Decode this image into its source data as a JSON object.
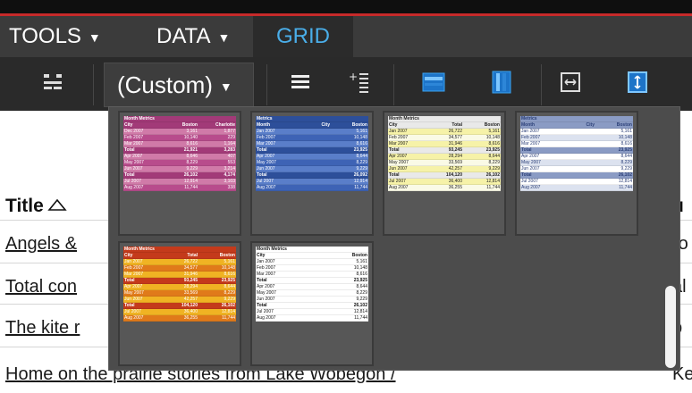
{
  "menu": {
    "items": [
      {
        "label": "TOOLS",
        "has_dropdown": true
      },
      {
        "label": "DATA",
        "has_dropdown": true
      },
      {
        "label": "GRID",
        "has_dropdown": false,
        "active": true
      }
    ]
  },
  "toolbar": {
    "style_select": {
      "value": "(Custom)",
      "caret": "▾"
    },
    "icons": [
      "grid-layout-icon",
      "outline-rows-icon",
      "add-subtotal-icon",
      "banding-rows-icon",
      "banding-columns-icon",
      "fit-to-content-icon",
      "fit-to-window-icon"
    ]
  },
  "colors": {
    "accent": "#4aaee9",
    "menubar": "#3b3b3b",
    "toolbar": "#2a2a2a",
    "topline": "#c62a2a"
  },
  "style_gallery": {
    "thumbnails": [
      {
        "name": "magenta-style",
        "header_bg": "#a23a78",
        "row_a": "#b84c8c",
        "row_b": "#d07aa8",
        "text": "#ffffff",
        "rows": [
          [
            "Month Metrics",
            "",
            ""
          ],
          [
            "City",
            "Boston",
            "Charlotte"
          ],
          [
            "Dec 2007",
            "3,161",
            "1,877"
          ],
          [
            "Feb 2007",
            "10,140",
            "229"
          ],
          [
            "Mar 2007",
            "8,616",
            "1,164"
          ],
          [
            "Total",
            "21,921",
            "3,283"
          ],
          [
            "Apr 2007",
            "8,646",
            "407"
          ],
          [
            "May 2007",
            "8,229",
            "553"
          ],
          [
            "Jun 2007",
            "9,229",
            "3,214"
          ],
          [
            "Total",
            "26,102",
            "4,174"
          ],
          [
            "Jul 2007",
            "12,914",
            "3,103"
          ],
          [
            "Aug 2007",
            "11,744",
            "338"
          ]
        ]
      },
      {
        "name": "blue-style",
        "header_bg": "#2d4f9a",
        "row_a": "#3e63b5",
        "row_b": "#5a7ec9",
        "text": "#ffffff",
        "rows": [
          [
            "Metrics",
            "",
            ""
          ],
          [
            "Month",
            "City",
            "Boston"
          ],
          [
            "Jan 2007",
            "",
            "5,161"
          ],
          [
            "Feb 2007",
            "",
            "10,148"
          ],
          [
            "Mar 2007",
            "",
            "8,616"
          ],
          [
            "Total",
            "",
            "23,925"
          ],
          [
            "Apr 2007",
            "",
            "8,644"
          ],
          [
            "May 2007",
            "",
            "8,229"
          ],
          [
            "Jun 2007",
            "",
            "9,229"
          ],
          [
            "Total",
            "",
            "26,092"
          ],
          [
            "Jul 2007",
            "",
            "12,914"
          ],
          [
            "Aug 2007",
            "",
            "11,744"
          ]
        ]
      },
      {
        "name": "yellow-style",
        "header_bg": "#e9e9e9",
        "row_a": "#fafae6",
        "row_b": "#f6f2a8",
        "text": "#222222",
        "rows": [
          [
            "Month Metrics",
            "",
            ""
          ],
          [
            "City",
            "Total",
            "Boston"
          ],
          [
            "Jan 2007",
            "26,722",
            "5,161"
          ],
          [
            "Feb 2007",
            "34,577",
            "10,148"
          ],
          [
            "Mar 2007",
            "31,946",
            "8,616"
          ],
          [
            "Total",
            "93,245",
            "23,925"
          ],
          [
            "Apr 2007",
            "28,294",
            "8,644"
          ],
          [
            "May 2007",
            "33,569",
            "8,229"
          ],
          [
            "Jun 2007",
            "42,257",
            "9,229"
          ],
          [
            "Total",
            "104,120",
            "26,102"
          ],
          [
            "Jul 2007",
            "36,400",
            "12,814"
          ],
          [
            "Aug 2007",
            "36,255",
            "11,744"
          ]
        ]
      },
      {
        "name": "grey-blue-style",
        "header_bg": "#8a9bc4",
        "row_a": "#dce2ef",
        "row_b": "#ffffff",
        "text": "#2a3e76",
        "rows": [
          [
            "Metrics",
            "",
            ""
          ],
          [
            "Month",
            "City",
            "Boston"
          ],
          [
            "Jan 2007",
            "",
            "5,161"
          ],
          [
            "Feb 2007",
            "",
            "10,148"
          ],
          [
            "Mar 2007",
            "",
            "8,616"
          ],
          [
            "Total",
            "",
            "23,925"
          ],
          [
            "Apr 2007",
            "",
            "8,644"
          ],
          [
            "May 2007",
            "",
            "8,229"
          ],
          [
            "Jun 2007",
            "",
            "9,229"
          ],
          [
            "Total",
            "",
            "26,102"
          ],
          [
            "Jul 2007",
            "",
            "12,814"
          ],
          [
            "Aug 2007",
            "",
            "11,744"
          ]
        ]
      },
      {
        "name": "orange-style",
        "header_bg": "#c43a1b",
        "row_a": "#e07a1a",
        "row_b": "#f0b323",
        "text": "#ffffff",
        "rows": [
          [
            "Month Metrics",
            "",
            ""
          ],
          [
            "City",
            "Total",
            "Boston"
          ],
          [
            "Jan 2007",
            "26,722",
            "5,161"
          ],
          [
            "Feb 2007",
            "34,577",
            "10,148"
          ],
          [
            "Mar 2007",
            "31,946",
            "8,616"
          ],
          [
            "Total",
            "93,245",
            "23,925"
          ],
          [
            "Apr 2007",
            "28,294",
            "8,644"
          ],
          [
            "May 2007",
            "33,569",
            "8,229"
          ],
          [
            "Jun 2007",
            "42,257",
            "9,229"
          ],
          [
            "Total",
            "104,120",
            "26,102"
          ],
          [
            "Jul 2007",
            "36,400",
            "12,814"
          ],
          [
            "Aug 2007",
            "36,255",
            "11,744"
          ]
        ]
      },
      {
        "name": "plain-style",
        "header_bg": "#ffffff",
        "row_a": "#ffffff",
        "row_b": "#ffffff",
        "text": "#111111",
        "rows": [
          [
            "Month Metrics",
            "",
            ""
          ],
          [
            "City",
            "",
            "Boston"
          ],
          [
            "Jan 2007",
            "",
            "5,161"
          ],
          [
            "Feb 2007",
            "",
            "10,148"
          ],
          [
            "Mar 2007",
            "",
            "8,616"
          ],
          [
            "Total",
            "",
            "23,925"
          ],
          [
            "Apr 2007",
            "",
            "8,644"
          ],
          [
            "May 2007",
            "",
            "8,229"
          ],
          [
            "Jun 2007",
            "",
            "9,229"
          ],
          [
            "Total",
            "",
            "26,102"
          ],
          [
            "Jul 2007",
            "",
            "12,814"
          ],
          [
            "Aug 2007",
            "",
            "11,744"
          ]
        ]
      }
    ]
  },
  "grid": {
    "title_header": "Title",
    "rows": [
      {
        "title": "Angels & ",
        "right": "ro"
      },
      {
        "title": "Total con",
        "right": "al"
      },
      {
        "title": "The kite r",
        "right": "p"
      },
      {
        "title": "Home on the prairie stories from Lake Wobegon /",
        "right": "Kei"
      }
    ],
    "right_header": "u"
  }
}
